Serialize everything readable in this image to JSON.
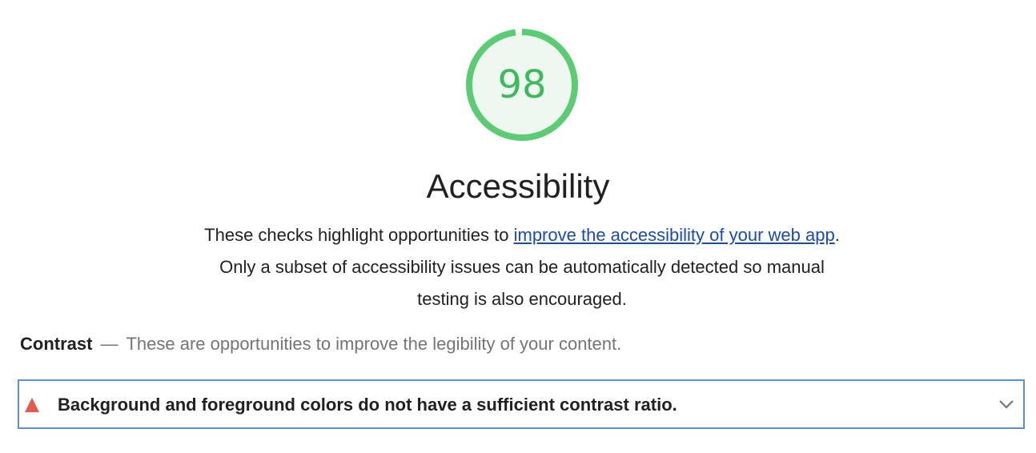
{
  "category": {
    "score": "98",
    "score_fraction": 0.98,
    "score_color": "#3dbb5c",
    "gauge_fill_color": "#eef8f0",
    "title": "Accessibility",
    "description": {
      "before_link": "These checks highlight opportunities to ",
      "link_text": "improve the accessibility of your web app",
      "after_link": ". Only a subset of accessibility issues can be automatically detected so manual testing is also encouraged."
    }
  },
  "group": {
    "title": "Contrast",
    "separator": "—",
    "description": "These are opportunities to improve the legibility of your content."
  },
  "audit": {
    "status_icon": "warning-triangle-icon",
    "status_color": "#e8574a",
    "title": "Background and foreground colors do not have a sufficient contrast ratio.",
    "expand_icon": "chevron-down-icon",
    "border_color": "#5b8fd8"
  }
}
